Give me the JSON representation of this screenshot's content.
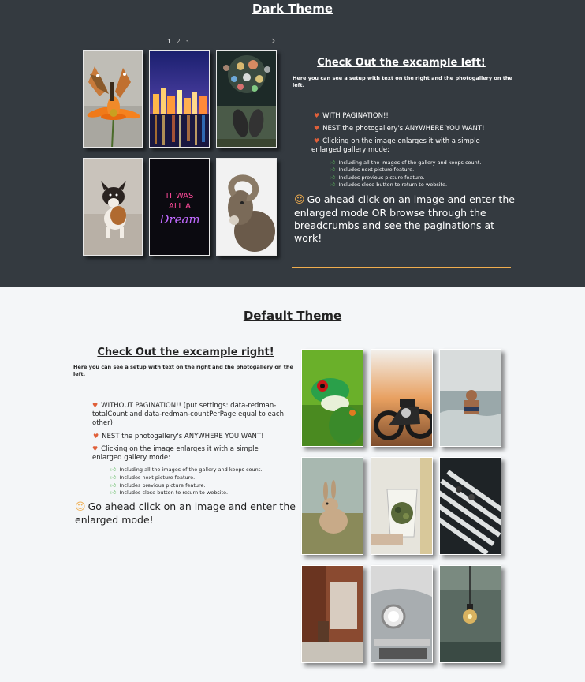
{
  "dark": {
    "title": "Dark Theme",
    "pagination": [
      "1",
      "2",
      "3"
    ],
    "next_icon": "chevron-right-icon",
    "card_title": "Check Out the excample left!",
    "intro": "Here you can see a setup with text on the right and the photogallery on the left.",
    "bullets": [
      "WITH PAGINATION!!",
      "NEST the photogallery's ANYWHERE YOU WANT!",
      "Clicking on the image enlarges it with a simple enlarged gallery mode:"
    ],
    "features": [
      "Including all the images of the gallery and keeps count.",
      "Includes next picture feature.",
      "Includes previous picture feature.",
      "Includes close button to return to website."
    ],
    "callout": "Go ahead click on an image and enter the enlarged mode OR browse through the breadcrumbs and see the paginations at work!",
    "images": [
      "butterfly-on-flower",
      "city-skyline-night",
      "bokeh-lights-feet",
      "running-dog",
      "neon-sign-dream",
      "bighorn-ram"
    ],
    "neon_text": [
      "IT WAS",
      "ALL A",
      "Dream"
    ]
  },
  "light": {
    "title": "Default Theme",
    "card_title": "Check Out the excample right!",
    "intro": "Here you can see a setup with text on the right and the photogallery on the left.",
    "bullets": [
      "WITHOUT PAGINATION!! (put settings: data-redman-totalCount and data-redman-countPerPage equal to each other)",
      "NEST the photogallery's ANYWHERE YOU WANT!",
      "Clicking on the image enlarges it with a simple enlarged gallery mode:"
    ],
    "features": [
      "Including all the images of the gallery and keeps count.",
      "Includes next picture feature.",
      "Includes previous picture feature.",
      "Includes close button to return to website."
    ],
    "callout": "Go ahead click on an image and enter the enlarged mode!",
    "images": [
      "green-tree-frog",
      "motorcycle-sunset",
      "man-in-ocean",
      "wild-rabbit",
      "smoothie-blender",
      "crosswalk-aerial",
      "brick-wall-room",
      "vintage-car-headlight",
      "hanging-light-bulb"
    ]
  },
  "colors": {
    "dark_bg": "#343a40",
    "light_bg": "#f4f6f8",
    "heart": "#e0603a",
    "thumb": "#5cb85c",
    "smile": "#f0ad4e",
    "rule_dark": "#f0ad4e",
    "rule_light": "#555555"
  }
}
